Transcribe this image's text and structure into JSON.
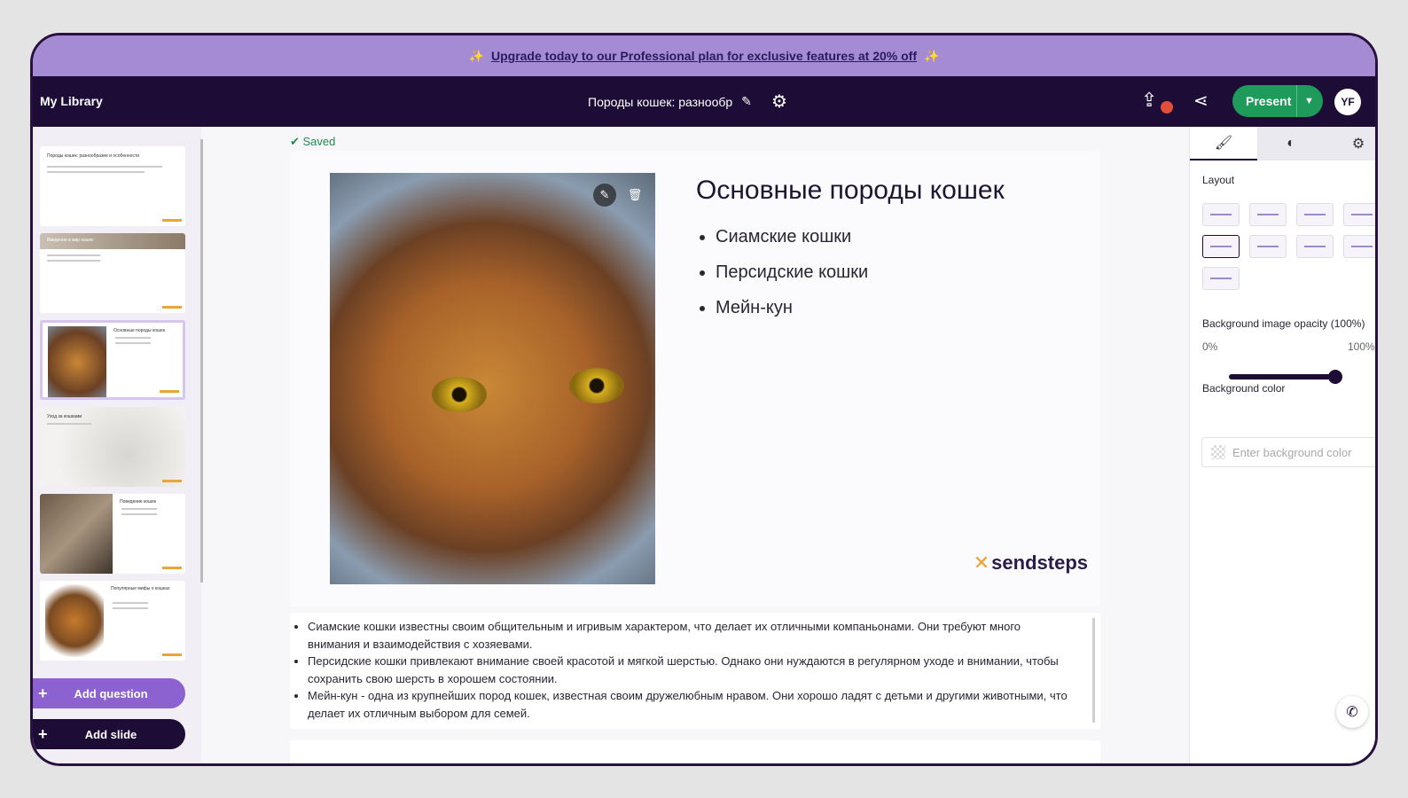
{
  "banner": {
    "text": "Upgrade today to our Professional plan for exclusive features at 20% off",
    "spark": "✨"
  },
  "topbar": {
    "library": "My Library",
    "doc_title": "Породы кошек: разнообр",
    "present_label": "Present",
    "avatar_initials": "YF"
  },
  "saved_status": "Saved",
  "slide": {
    "title": "Основные породы кошек",
    "bullets": [
      "Сиамские кошки",
      "Персидские кошки",
      "Мейн-кун"
    ],
    "brand": "sendsteps"
  },
  "notes": [
    "Сиамские кошки известны своим общительным и игривым характером, что делает их отличными компаньонами. Они требуют много внимания и взаимодействия с хозяевами.",
    "Персидские кошки привлекают внимание своей красотой и мягкой шерстью. Однако они нуждаются в регулярном уходе и внимании, чтобы сохранить свою шерсть в хорошем состоянии.",
    "Мейн-кун - одна из крупнейших пород кошек, известная своим дружелюбным нравом. Они хорошо ладят с детьми и другими животными, что делает их отличным выбором для семей."
  ],
  "thumbnails": [
    {
      "title": "Породы кошек: разнообразие и особенности"
    },
    {
      "title": "Введение в мир кошек"
    },
    {
      "title": "Основные породы кошек"
    },
    {
      "title": "Уход за кошками"
    },
    {
      "title": "Поведение кошек"
    },
    {
      "title": "Популярные мифы о кошках"
    }
  ],
  "sidebar_buttons": {
    "add_question": "Add question",
    "add_slide": "Add slide"
  },
  "right_panel": {
    "layout_label": "Layout",
    "opacity_label": "Background image opacity (100%)",
    "opacity_min": "0%",
    "opacity_max": "100%",
    "opacity_value": 1.0,
    "bg_color_label": "Background color",
    "bg_color_placeholder": "Enter background color"
  },
  "colors": {
    "accent": "#8c62d0",
    "dark": "#1d0c35",
    "present": "#1e9a5a",
    "banner": "#a48bd3"
  }
}
